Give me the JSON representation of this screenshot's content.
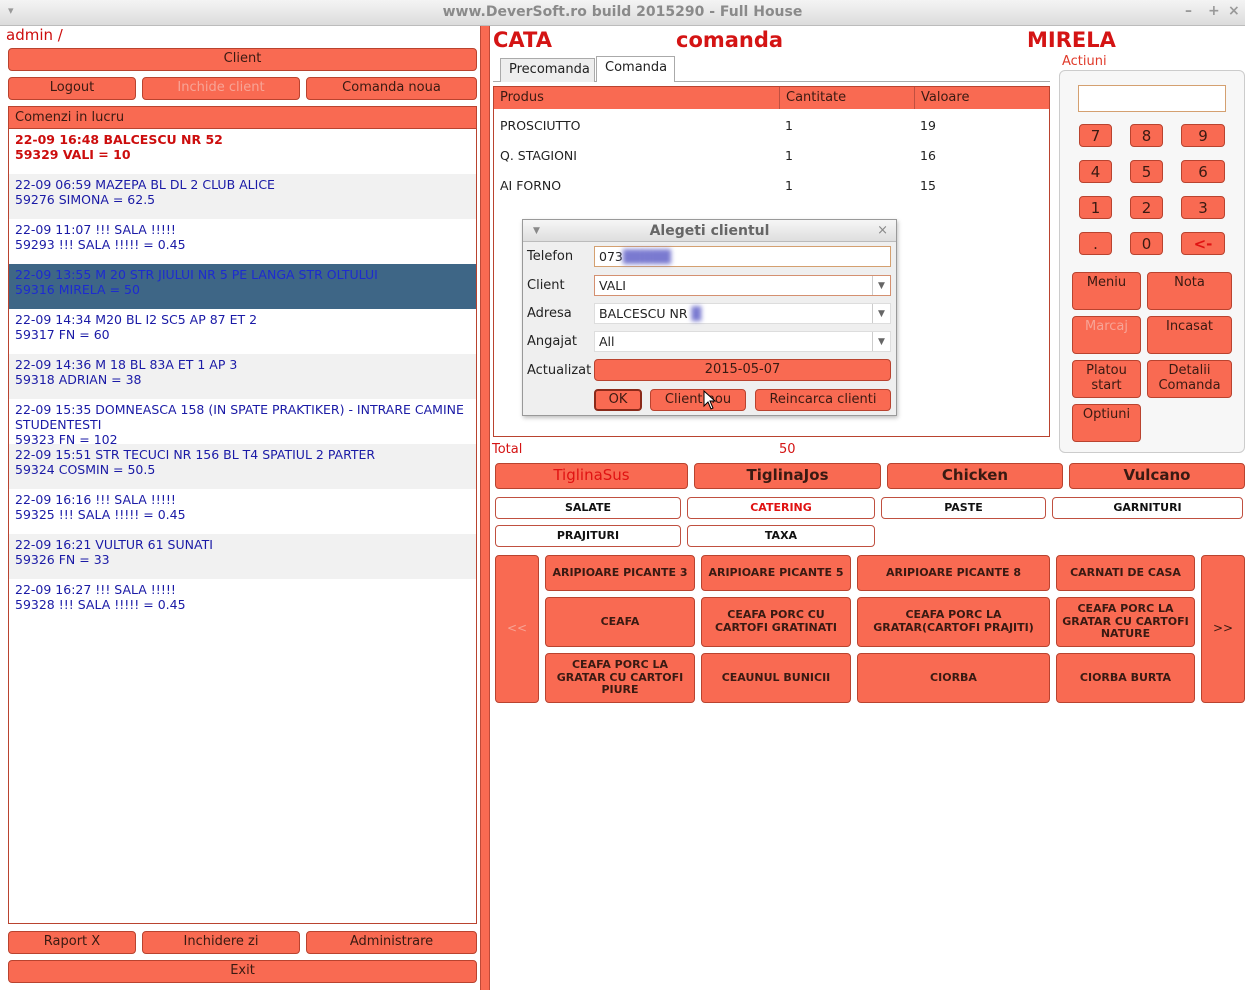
{
  "window": {
    "title": "www.DeverSoft.ro        build 2015290 - Full House"
  },
  "left": {
    "user_label": "admin /",
    "client_button": "Client",
    "logout_button": "Logout",
    "inchide_client_button": "Inchide client",
    "comanda_noua_button": "Comanda noua",
    "orders_header": "Comenzi in lucru",
    "orders": [
      {
        "line1": "22-09 16:48 BALCESCU NR 52",
        "line2": "59329 VALI = 10"
      },
      {
        "line1": "22-09 06:59 MAZEPA BL DL 2 CLUB ALICE",
        "line2": "59276 SIMONA = 62.5"
      },
      {
        "line1": "22-09 11:07 !!! SALA !!!!!",
        "line2": "59293 !!! SALA !!!!! = 0.45"
      },
      {
        "line1": "22-09 13:55 M 20 STR JIULUI NR 5 PE LANGA STR OLTULUI",
        "line2": "59316 MIRELA = 50"
      },
      {
        "line1": "22-09 14:34 M20 BL I2 SC5 AP 87 ET 2",
        "line2": "59317 FN = 60"
      },
      {
        "line1": "22-09 14:36 M 18 BL 83A ET 1 AP 3",
        "line2": "59318 ADRIAN = 38"
      },
      {
        "line1": "22-09 15:35 DOMNEASCA 158 (IN SPATE PRAKTIKER) - INTRARE CAMINE STUDENTESTI",
        "line2": "59323 FN = 102"
      },
      {
        "line1": "22-09 15:51 STR TECUCI NR 156 BL T4 SPATIUL 2 PARTER",
        "line2": "59324 COSMIN = 50.5"
      },
      {
        "line1": "22-09 16:16 !!! SALA !!!!!",
        "line2": "59325 !!! SALA !!!!! = 0.45"
      },
      {
        "line1": "22-09 16:21 VULTUR 61 SUNATI",
        "line2": "59326 FN = 33"
      },
      {
        "line1": "22-09 16:27 !!! SALA !!!!!",
        "line2": "59328 !!! SALA !!!!! = 0.45"
      }
    ],
    "raport_button": "Raport X",
    "inchidere_button": "Inchidere zi",
    "administrare_button": "Administrare",
    "exit_button": "Exit"
  },
  "header": {
    "left": "CATA",
    "center": "comanda",
    "right": "MIRELA",
    "actions_label": "Actiuni"
  },
  "tabs": [
    {
      "label": "Precomanda"
    },
    {
      "label": "Comanda"
    }
  ],
  "table": {
    "columns": [
      "Produs",
      "Cantitate",
      "Valoare"
    ],
    "rows": [
      {
        "produs": "PROSCIUTTO",
        "cantitate": "1",
        "valoare": "19"
      },
      {
        "produs": "Q. STAGIONI",
        "cantitate": "1",
        "valoare": "16"
      },
      {
        "produs": "AI FORNO",
        "cantitate": "1",
        "valoare": "15"
      }
    ],
    "total_label": "Total",
    "total_value": "50"
  },
  "dialog": {
    "title": "Alegeti clientul",
    "telefon_label": "Telefon",
    "telefon_value": "073",
    "client_label": "Client",
    "client_value": "VALI",
    "adresa_label": "Adresa",
    "adresa_value": "BALCESCU NR",
    "angajat_label": "Angajat",
    "angajat_value": "All",
    "actualizat_label": "Actualizat",
    "actualizat_value": "2015-05-07",
    "ok_button": "OK",
    "client_nou_button": "Client nou",
    "reincarca_button": "Reincarca clienti"
  },
  "numpad": {
    "keys": [
      "7",
      "8",
      "9",
      "4",
      "5",
      "6",
      "1",
      "2",
      "3",
      ".",
      "0",
      "<-"
    ],
    "meniu": "Meniu",
    "nota": "Nota",
    "marcaj": "Marcaj",
    "incasat": "Incasat",
    "platou_start": "Platou start",
    "detalii_comanda": "Detalii Comanda",
    "optiuni": "Optiuni"
  },
  "categories": {
    "big": [
      "TiglinaSus",
      "TiglinaJos",
      "Chicken",
      "Vulcano"
    ],
    "small": [
      "SALATE",
      "CATERING",
      "PASTE",
      "GARNITURI",
      "PRAJITURI",
      "TAXA"
    ]
  },
  "products": {
    "prev": "<<",
    "next": ">>",
    "items": [
      "ARIPIOARE PICANTE 3",
      "ARIPIOARE PICANTE 5",
      "ARIPIOARE PICANTE 8",
      "CARNATI DE CASA",
      "CEAFA",
      "CEAFA PORC CU CARTOFI GRATINATI",
      "CEAFA PORC LA GRATAR(CARTOFI PRAJITI)",
      "CEAFA PORC LA GRATAR CU CARTOFI NATURE",
      "CEAFA PORC LA GRATAR CU CARTOFI PIURE",
      "CEAUNUL BUNICII",
      "CIORBA",
      "CIORBA BURTA"
    ]
  },
  "colors": {
    "accent": "#f96a52",
    "header_red": "#d41414",
    "selected_row": "#3e6686",
    "order_text": "#1a1aa6"
  }
}
